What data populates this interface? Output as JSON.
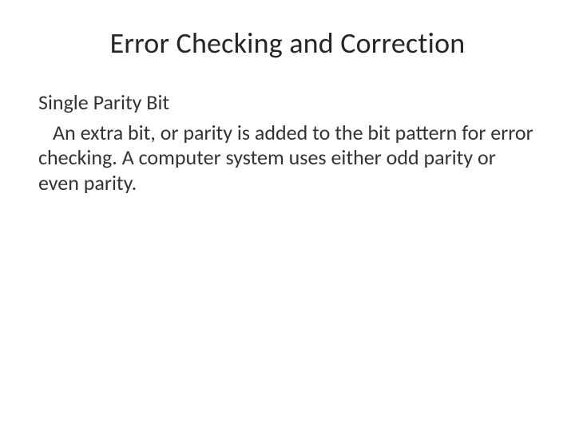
{
  "slide": {
    "title": "Error Checking and Correction",
    "subheading": "Single Parity Bit",
    "body": "An extra bit, or parity is added to the bit pattern for error checking. A computer system uses either odd parity or even parity."
  }
}
